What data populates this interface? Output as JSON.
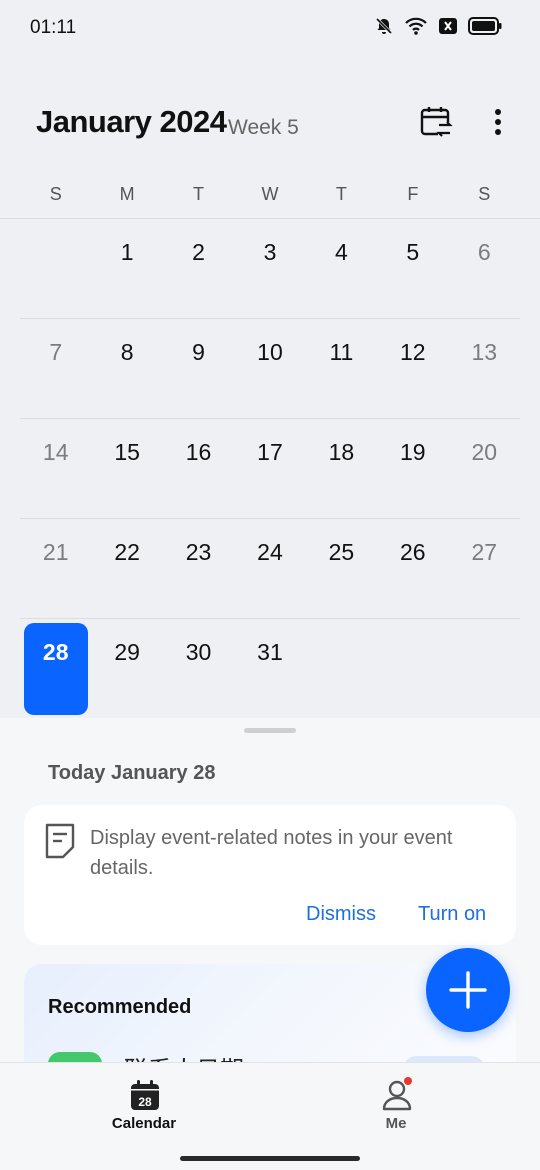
{
  "status_bar": {
    "time": "01:11",
    "icons": [
      "bell-muted-icon",
      "wifi-icon",
      "close-box-icon",
      "battery-icon"
    ]
  },
  "header": {
    "month_title": "January 2024",
    "week_label": "Week 5",
    "icons": [
      "calendar-switch-icon",
      "more-vertical-icon"
    ]
  },
  "weekdays": [
    "S",
    "M",
    "T",
    "W",
    "T",
    "F",
    "S"
  ],
  "calendar": {
    "today": "28",
    "weeks": [
      [
        "",
        "1",
        "2",
        "3",
        "4",
        "5",
        "6"
      ],
      [
        "7",
        "8",
        "9",
        "10",
        "11",
        "12",
        "13"
      ],
      [
        "14",
        "15",
        "16",
        "17",
        "18",
        "19",
        "20"
      ],
      [
        "21",
        "22",
        "23",
        "24",
        "25",
        "26",
        "27"
      ],
      [
        "28",
        "29",
        "30",
        "31",
        "",
        "",
        ""
      ]
    ]
  },
  "sheet": {
    "today_label": "Today  January 28",
    "notes_card": {
      "text": "Display event-related notes in your event details.",
      "dismiss_label": "Dismiss",
      "turn_on_label": "Turn on"
    },
    "recommended": {
      "title": "Recommended",
      "item_text": "联系人日期"
    }
  },
  "bottom_nav": {
    "items": [
      {
        "label": "Calendar",
        "icon": "calendar-icon",
        "icon_text": "28",
        "selected": true
      },
      {
        "label": "Me",
        "icon": "person-icon",
        "badge": true
      }
    ]
  },
  "colors": {
    "accent": "#0a64ff",
    "link": "#1f6fe0",
    "badge": "#e7382d"
  }
}
